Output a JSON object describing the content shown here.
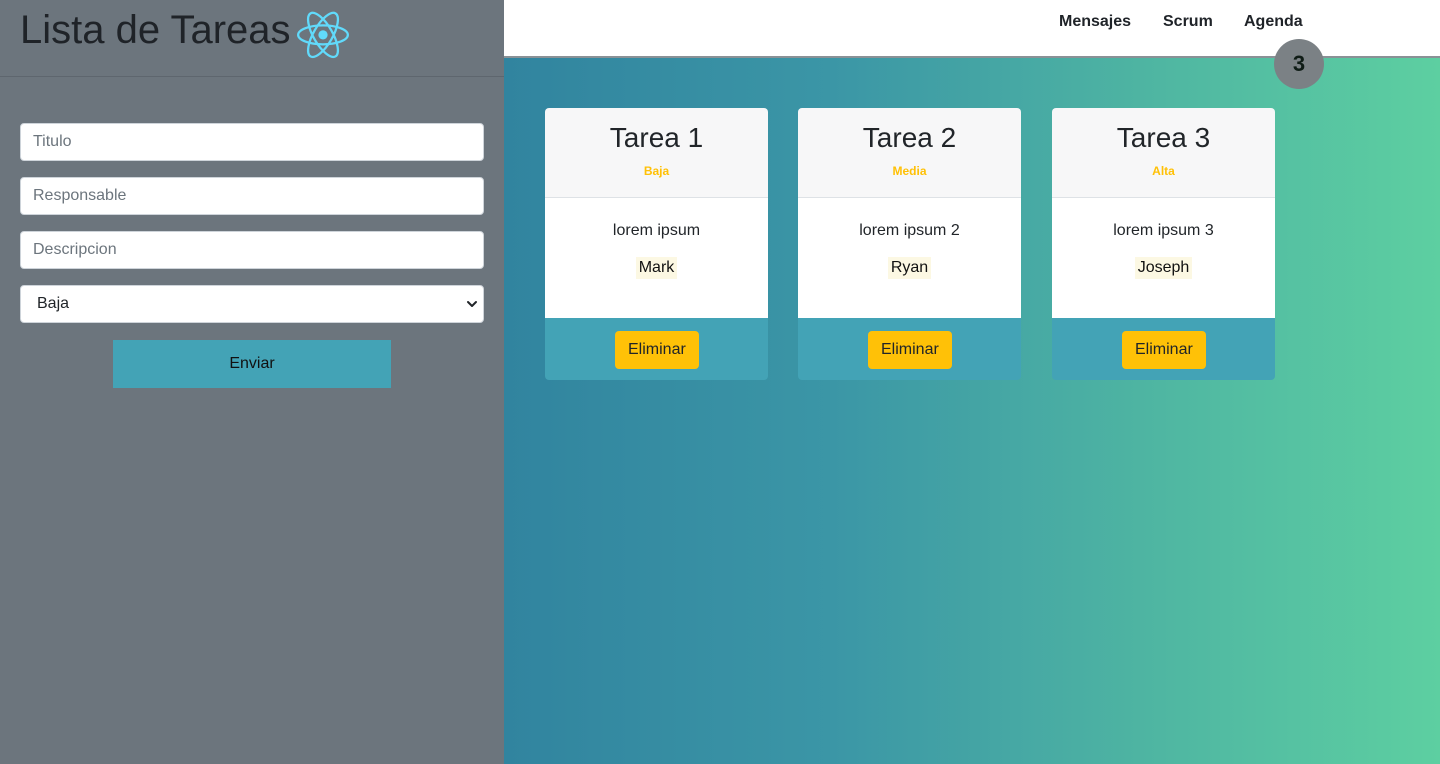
{
  "app": {
    "title": "Lista de Tareas",
    "logo_icon": "react-atom-icon"
  },
  "form": {
    "titulo_placeholder": "Titulo",
    "responsable_placeholder": "Responsable",
    "descripcion_placeholder": "Descripcion",
    "priority_selected": "Baja",
    "submit_label": "Enviar"
  },
  "nav": {
    "links": [
      "Mensajes",
      "Scrum",
      "Agenda"
    ],
    "task_count": "3"
  },
  "tasks": [
    {
      "title": "Tarea 1",
      "priority": "Baja",
      "description": "lorem ipsum",
      "responsible": "Mark",
      "delete_label": "Eliminar"
    },
    {
      "title": "Tarea 2",
      "priority": "Media",
      "description": "lorem ipsum 2",
      "responsible": "Ryan",
      "delete_label": "Eliminar"
    },
    {
      "title": "Tarea 3",
      "priority": "Alta",
      "description": "lorem ipsum 3",
      "responsible": "Joseph",
      "delete_label": "Eliminar"
    }
  ],
  "colors": {
    "panel": "#6c757d",
    "accent_teal": "#43a3b6",
    "priority": "#ffc107",
    "gradient_start": "#31849f",
    "gradient_end": "#5dcfa1"
  }
}
